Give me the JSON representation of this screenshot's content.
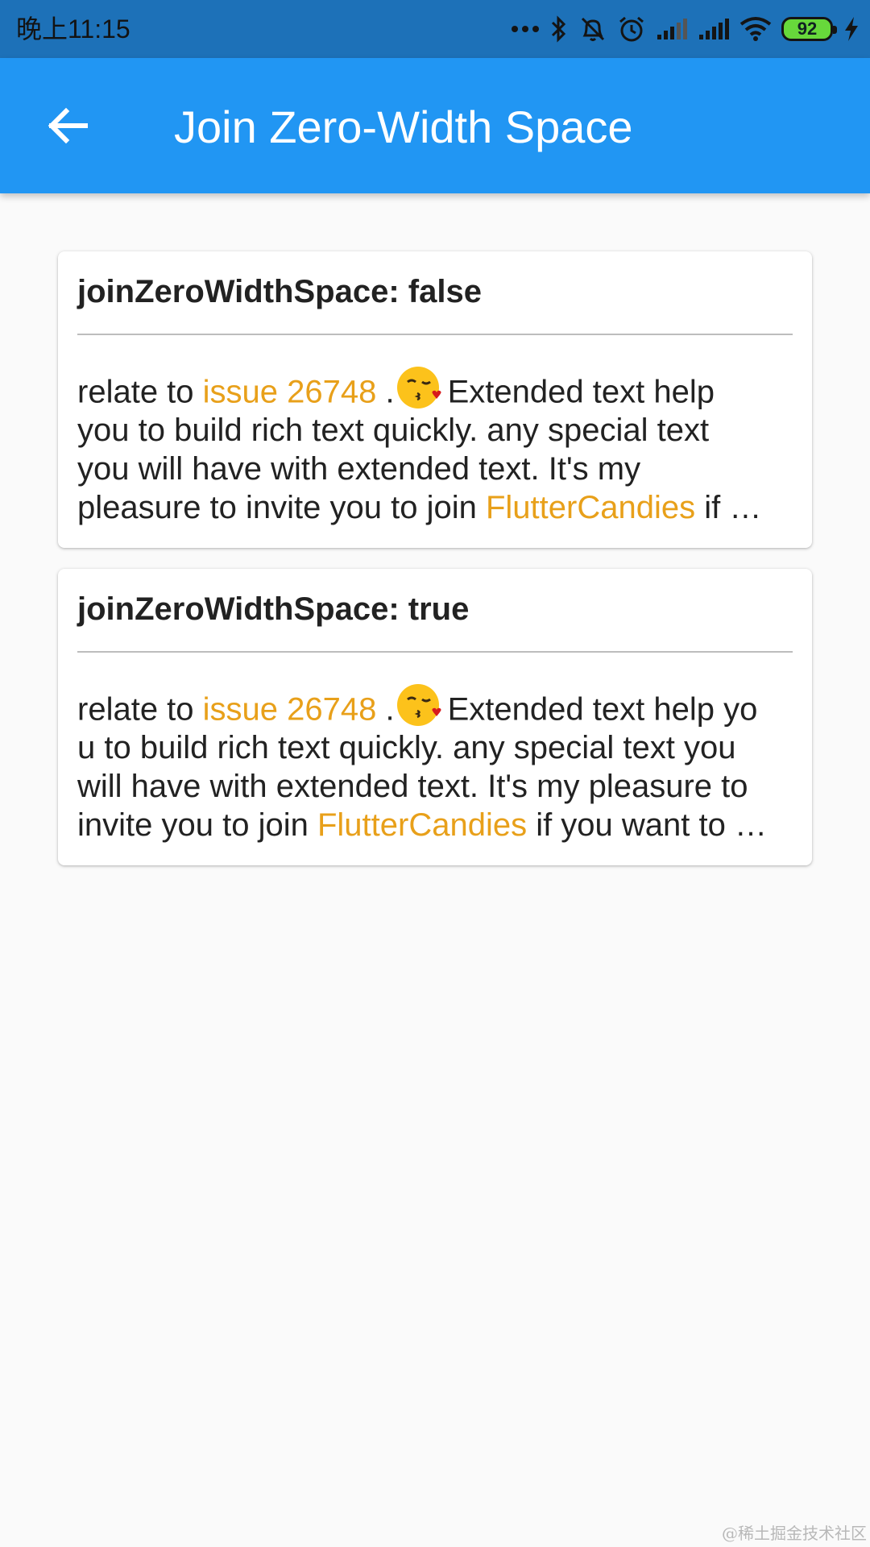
{
  "status_bar": {
    "time": "晚上11:15",
    "battery_level": "92",
    "icons": [
      "more-dots-icon",
      "bluetooth-icon",
      "bell-muted-icon",
      "alarm-icon",
      "signal-icon",
      "signal-icon",
      "wifi-icon",
      "battery-icon",
      "charging-icon"
    ]
  },
  "app_bar": {
    "title": "Join Zero-Width Space",
    "back_icon": "arrow-back-icon",
    "color": "#2196f3"
  },
  "cards": [
    {
      "header": "joinZeroWidthSpace: false",
      "lines": [
        {
          "a": "relate to ",
          "link": "issue 26748",
          "b": " .",
          "c": "Extended text help"
        },
        {
          "text": "you to build rich text quickly. any special text"
        },
        {
          "text": "you will have with extended text. It's my"
        },
        {
          "a": "pleasure to invite you to join ",
          "link": "FlutterCandies",
          "b": " if …"
        }
      ]
    },
    {
      "header": "joinZeroWidthSpace: true",
      "lines": [
        {
          "a": "relate to ",
          "link": "issue 26748",
          "b": " .",
          "c": "Extended text help yo"
        },
        {
          "text": "u to build rich text quickly. any special text you"
        },
        {
          "text": "will have with extended text. It's my pleasure to"
        },
        {
          "a": "invite you to join ",
          "link": "FlutterCandies",
          "b": " if you want to …"
        }
      ]
    }
  ],
  "emoji_icon": "kissing-face-icon",
  "colors": {
    "link": "#e8a01a",
    "status_bar": "#1d71b8",
    "background": "#fafafa"
  },
  "watermark": "@稀土掘金技术社区"
}
